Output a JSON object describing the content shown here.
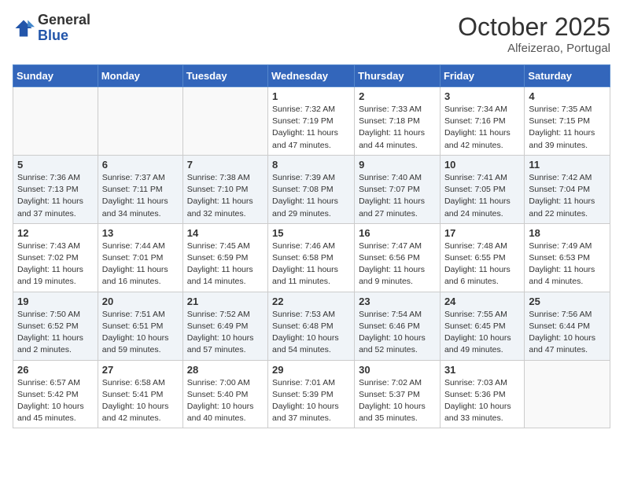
{
  "header": {
    "logo_general": "General",
    "logo_blue": "Blue",
    "month_title": "October 2025",
    "subtitle": "Alfeizerao, Portugal"
  },
  "days_of_week": [
    "Sunday",
    "Monday",
    "Tuesday",
    "Wednesday",
    "Thursday",
    "Friday",
    "Saturday"
  ],
  "weeks": [
    {
      "shaded": false,
      "days": [
        {
          "num": "",
          "info": ""
        },
        {
          "num": "",
          "info": ""
        },
        {
          "num": "",
          "info": ""
        },
        {
          "num": "1",
          "info": "Sunrise: 7:32 AM\nSunset: 7:19 PM\nDaylight: 11 hours\nand 47 minutes."
        },
        {
          "num": "2",
          "info": "Sunrise: 7:33 AM\nSunset: 7:18 PM\nDaylight: 11 hours\nand 44 minutes."
        },
        {
          "num": "3",
          "info": "Sunrise: 7:34 AM\nSunset: 7:16 PM\nDaylight: 11 hours\nand 42 minutes."
        },
        {
          "num": "4",
          "info": "Sunrise: 7:35 AM\nSunset: 7:15 PM\nDaylight: 11 hours\nand 39 minutes."
        }
      ]
    },
    {
      "shaded": true,
      "days": [
        {
          "num": "5",
          "info": "Sunrise: 7:36 AM\nSunset: 7:13 PM\nDaylight: 11 hours\nand 37 minutes."
        },
        {
          "num": "6",
          "info": "Sunrise: 7:37 AM\nSunset: 7:11 PM\nDaylight: 11 hours\nand 34 minutes."
        },
        {
          "num": "7",
          "info": "Sunrise: 7:38 AM\nSunset: 7:10 PM\nDaylight: 11 hours\nand 32 minutes."
        },
        {
          "num": "8",
          "info": "Sunrise: 7:39 AM\nSunset: 7:08 PM\nDaylight: 11 hours\nand 29 minutes."
        },
        {
          "num": "9",
          "info": "Sunrise: 7:40 AM\nSunset: 7:07 PM\nDaylight: 11 hours\nand 27 minutes."
        },
        {
          "num": "10",
          "info": "Sunrise: 7:41 AM\nSunset: 7:05 PM\nDaylight: 11 hours\nand 24 minutes."
        },
        {
          "num": "11",
          "info": "Sunrise: 7:42 AM\nSunset: 7:04 PM\nDaylight: 11 hours\nand 22 minutes."
        }
      ]
    },
    {
      "shaded": false,
      "days": [
        {
          "num": "12",
          "info": "Sunrise: 7:43 AM\nSunset: 7:02 PM\nDaylight: 11 hours\nand 19 minutes."
        },
        {
          "num": "13",
          "info": "Sunrise: 7:44 AM\nSunset: 7:01 PM\nDaylight: 11 hours\nand 16 minutes."
        },
        {
          "num": "14",
          "info": "Sunrise: 7:45 AM\nSunset: 6:59 PM\nDaylight: 11 hours\nand 14 minutes."
        },
        {
          "num": "15",
          "info": "Sunrise: 7:46 AM\nSunset: 6:58 PM\nDaylight: 11 hours\nand 11 minutes."
        },
        {
          "num": "16",
          "info": "Sunrise: 7:47 AM\nSunset: 6:56 PM\nDaylight: 11 hours\nand 9 minutes."
        },
        {
          "num": "17",
          "info": "Sunrise: 7:48 AM\nSunset: 6:55 PM\nDaylight: 11 hours\nand 6 minutes."
        },
        {
          "num": "18",
          "info": "Sunrise: 7:49 AM\nSunset: 6:53 PM\nDaylight: 11 hours\nand 4 minutes."
        }
      ]
    },
    {
      "shaded": true,
      "days": [
        {
          "num": "19",
          "info": "Sunrise: 7:50 AM\nSunset: 6:52 PM\nDaylight: 11 hours\nand 2 minutes."
        },
        {
          "num": "20",
          "info": "Sunrise: 7:51 AM\nSunset: 6:51 PM\nDaylight: 10 hours\nand 59 minutes."
        },
        {
          "num": "21",
          "info": "Sunrise: 7:52 AM\nSunset: 6:49 PM\nDaylight: 10 hours\nand 57 minutes."
        },
        {
          "num": "22",
          "info": "Sunrise: 7:53 AM\nSunset: 6:48 PM\nDaylight: 10 hours\nand 54 minutes."
        },
        {
          "num": "23",
          "info": "Sunrise: 7:54 AM\nSunset: 6:46 PM\nDaylight: 10 hours\nand 52 minutes."
        },
        {
          "num": "24",
          "info": "Sunrise: 7:55 AM\nSunset: 6:45 PM\nDaylight: 10 hours\nand 49 minutes."
        },
        {
          "num": "25",
          "info": "Sunrise: 7:56 AM\nSunset: 6:44 PM\nDaylight: 10 hours\nand 47 minutes."
        }
      ]
    },
    {
      "shaded": false,
      "days": [
        {
          "num": "26",
          "info": "Sunrise: 6:57 AM\nSunset: 5:42 PM\nDaylight: 10 hours\nand 45 minutes."
        },
        {
          "num": "27",
          "info": "Sunrise: 6:58 AM\nSunset: 5:41 PM\nDaylight: 10 hours\nand 42 minutes."
        },
        {
          "num": "28",
          "info": "Sunrise: 7:00 AM\nSunset: 5:40 PM\nDaylight: 10 hours\nand 40 minutes."
        },
        {
          "num": "29",
          "info": "Sunrise: 7:01 AM\nSunset: 5:39 PM\nDaylight: 10 hours\nand 37 minutes."
        },
        {
          "num": "30",
          "info": "Sunrise: 7:02 AM\nSunset: 5:37 PM\nDaylight: 10 hours\nand 35 minutes."
        },
        {
          "num": "31",
          "info": "Sunrise: 7:03 AM\nSunset: 5:36 PM\nDaylight: 10 hours\nand 33 minutes."
        },
        {
          "num": "",
          "info": ""
        }
      ]
    }
  ]
}
